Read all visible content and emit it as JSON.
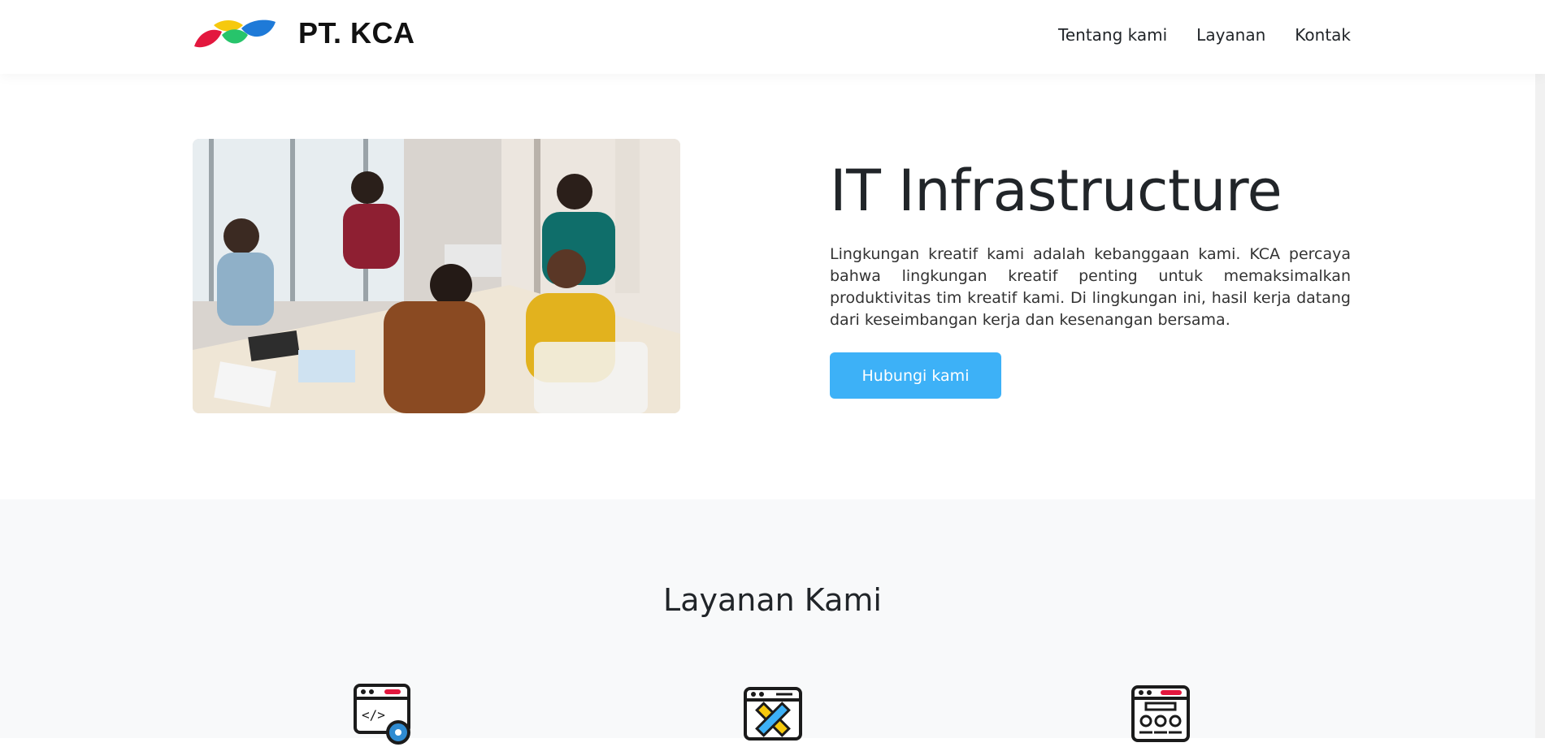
{
  "header": {
    "brand": "PT. KCA",
    "nav": [
      "Tentang kami",
      "Layanan",
      "Kontak"
    ]
  },
  "hero": {
    "title": "IT Infrastructure",
    "text": "Lingkungan kreatif kami adalah kebanggaan kami. KCA percaya bahwa lingkungan kreatif penting untuk memaksimalkan produktivitas tim kreatif kami. Di lingkungan ini, hasil kerja datang dari keseimbangan kerja dan kesenangan bersama.",
    "button": "Hubungi kami"
  },
  "services": {
    "title": "Layanan Kami",
    "icons": [
      "code-settings-icon",
      "design-tools-icon",
      "web-layout-icon"
    ]
  },
  "colors": {
    "accent": "#3db1f7",
    "logo_red": "#e3173e",
    "logo_yellow": "#f6c90e",
    "logo_green": "#27c46b",
    "logo_blue": "#1e7ad8",
    "services_bg": "#f8f9fa"
  }
}
